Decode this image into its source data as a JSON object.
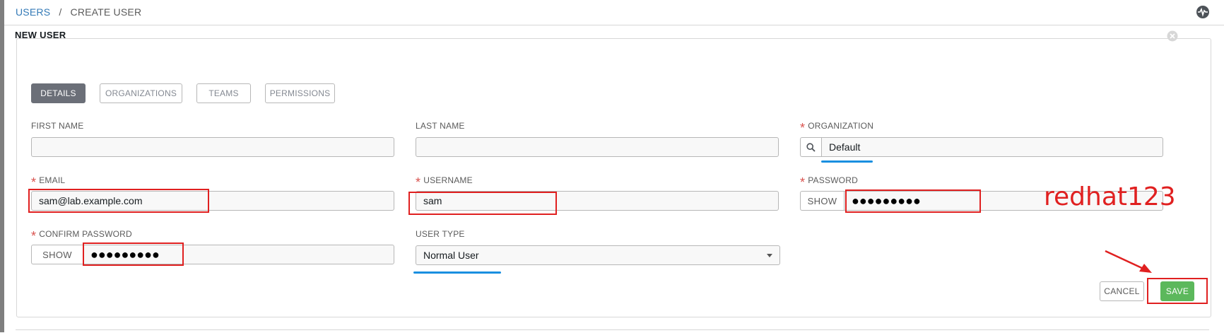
{
  "breadcrumb": {
    "parent": "USERS",
    "separator": "/",
    "current": "CREATE USER"
  },
  "header": {
    "activity_icon": "activity-icon"
  },
  "panel": {
    "title": "NEW USER",
    "close_icon": "close-icon"
  },
  "tabs": [
    {
      "label": "DETAILS",
      "active": true
    },
    {
      "label": "ORGANIZATIONS",
      "active": false
    },
    {
      "label": "TEAMS",
      "active": false
    },
    {
      "label": "PERMISSIONS",
      "active": false
    }
  ],
  "form": {
    "first_name": {
      "label": "FIRST NAME",
      "value": "",
      "required": false
    },
    "last_name": {
      "label": "LAST NAME",
      "value": "",
      "required": false
    },
    "organization": {
      "label": "ORGANIZATION",
      "value": "Default",
      "required": true,
      "required_mark": "*"
    },
    "email": {
      "label": "EMAIL",
      "value": "sam@lab.example.com",
      "required": true,
      "required_mark": "*"
    },
    "username": {
      "label": "USERNAME",
      "value": "sam",
      "required": true,
      "required_mark": "*"
    },
    "password": {
      "label": "PASSWORD",
      "show_label": "SHOW",
      "value": "●●●●●●●●●",
      "required": true,
      "required_mark": "*"
    },
    "confirm_password": {
      "label": "CONFIRM PASSWORD",
      "show_label": "SHOW",
      "value": "●●●●●●●●●",
      "required": true,
      "required_mark": "*"
    },
    "user_type": {
      "label": "USER TYPE",
      "value": "Normal User",
      "required": false
    }
  },
  "actions": {
    "cancel_label": "CANCEL",
    "save_label": "SAVE"
  },
  "annotation": {
    "password_note": "redhat123"
  },
  "colors": {
    "accent": "#337ab7",
    "save": "#5cb85c",
    "required": "#d9534f",
    "annotation_red": "#e02020",
    "annotation_blue": "#1a8fe0",
    "active_tab": "#6b6f78"
  }
}
